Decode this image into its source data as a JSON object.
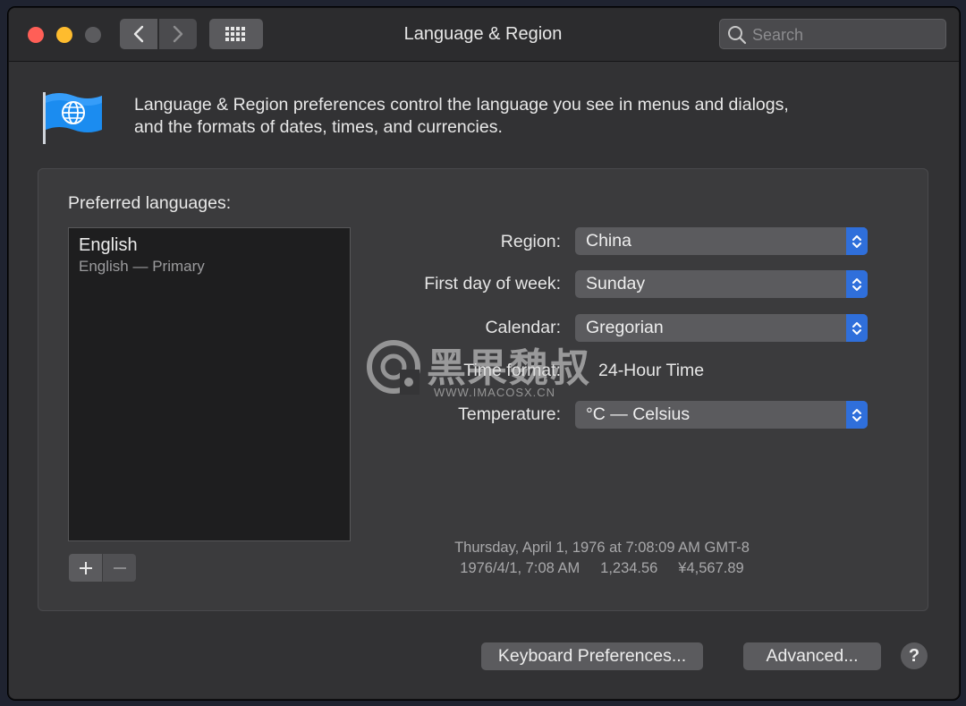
{
  "window": {
    "title": "Language & Region",
    "search_placeholder": "Search"
  },
  "header": {
    "description_line1": "Language & Region preferences control the language you see in menus and dialogs,",
    "description_line2": "and the formats of dates, times, and currencies."
  },
  "languages": {
    "label": "Preferred languages:",
    "items": [
      {
        "name": "English",
        "subtitle": "English — Primary"
      }
    ]
  },
  "formats": {
    "region_label": "Region:",
    "region_value": "China",
    "first_day_label": "First day of week:",
    "first_day_value": "Sunday",
    "calendar_label": "Calendar:",
    "calendar_value": "Gregorian",
    "time_format_label": "Time format:",
    "time_format_value": "24-Hour Time",
    "temperature_label": "Temperature:",
    "temperature_value": "°C — Celsius"
  },
  "sample": {
    "line1": "Thursday, April 1, 1976 at 7:08:09 AM GMT-8",
    "line2": "1976/4/1, 7:08 AM     1,234.56     ¥4,567.89"
  },
  "buttons": {
    "keyboard": "Keyboard Preferences...",
    "advanced": "Advanced...",
    "help": "?"
  },
  "watermark": {
    "text": "黑果魏叔",
    "url": "WWW.IMACOSX.CN"
  },
  "colors": {
    "accent": "#2f6fdb",
    "close": "#ff5f57",
    "minimize": "#febc2e"
  }
}
